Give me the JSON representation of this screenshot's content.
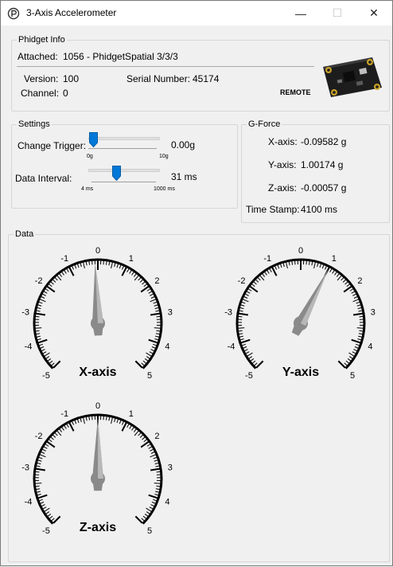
{
  "window": {
    "title": "3-Axis Accelerometer",
    "minimize_glyph": "—",
    "maximize_glyph": "☐",
    "close_glyph": "✕"
  },
  "phidget_info": {
    "legend": "Phidget Info",
    "attached_label": "Attached:",
    "attached_value": "1056 - PhidgetSpatial 3/3/3",
    "version_label": "Version:",
    "version_value": "100",
    "serial_label": "Serial Number:",
    "serial_value": "45174",
    "channel_label": "Channel:",
    "channel_value": "0",
    "remote_label": "REMOTE",
    "board_icon": "circuit-board-image"
  },
  "settings": {
    "legend": "Settings",
    "change_trigger": {
      "label": "Change Trigger:",
      "value_text": "0.00g",
      "min_label": "0g",
      "max_label": "10g",
      "fraction": 0.0
    },
    "data_interval": {
      "label": "Data Interval:",
      "value_text": "31 ms",
      "min_label": "4 ms",
      "max_label": "1000 ms",
      "fraction": 0.34
    }
  },
  "gforce": {
    "legend": "G-Force",
    "x_label": "X-axis:",
    "x_value": "-0.09582 g",
    "y_label": "Y-axis:",
    "y_value": "1.00174 g",
    "z_label": "Z-axis:",
    "z_value": "-0.00057 g",
    "timestamp_label": "Time Stamp:",
    "timestamp_value": "4100 ms"
  },
  "data_panel": {
    "legend": "Data",
    "gauges": [
      {
        "name": "X-axis",
        "value": -0.09582
      },
      {
        "name": "Y-axis",
        "value": 1.00174
      },
      {
        "name": "Z-axis",
        "value": -0.00057
      }
    ],
    "scale_labels": [
      "-5",
      "-4",
      "-3",
      "-2",
      "-1",
      "0",
      "1",
      "2",
      "3",
      "4",
      "5"
    ],
    "scale_min": -5,
    "scale_max": 5
  },
  "colors": {
    "accent": "#0078d7",
    "needle": "#8a8a8a",
    "dial": "#000000"
  }
}
